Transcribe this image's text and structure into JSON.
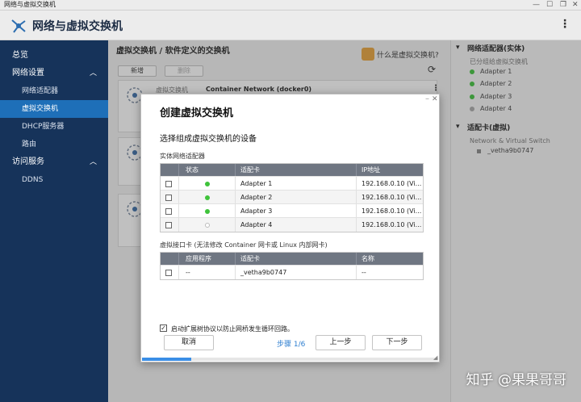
{
  "window": {
    "title": "网络与虚拟交换机"
  },
  "header": {
    "app_title": "网络与虚拟交换机",
    "menu_icon": "kebab-icon"
  },
  "sidebar": {
    "items": [
      {
        "label": "总览",
        "level": 0
      },
      {
        "label": "网络设置",
        "level": 0,
        "expanded": true
      },
      {
        "label": "网络适配器",
        "level": 1
      },
      {
        "label": "虚拟交换机",
        "level": 1,
        "active": true
      },
      {
        "label": "DHCP服务器",
        "level": 1
      },
      {
        "label": "路由",
        "level": 1
      },
      {
        "label": "访问服务",
        "level": 0,
        "expanded": true
      },
      {
        "label": "DDNS",
        "level": 1
      }
    ]
  },
  "main": {
    "title": "虚拟交换机 / 软件定义的交换机",
    "help_link": "什么是虚拟交换机?",
    "add_button": "新增",
    "delete_button": "删除",
    "card": {
      "label": "虚拟交换机",
      "name": "Container Network (docker0)"
    }
  },
  "right_panel": {
    "section1_title": "网络适配器(实体)",
    "section1_subtitle": "已分组给虚拟交换机",
    "adapters": [
      {
        "name": "Adapter 1",
        "status": "connected"
      },
      {
        "name": "Adapter 2",
        "status": "connected"
      },
      {
        "name": "Adapter 3",
        "status": "connected"
      },
      {
        "name": "Adapter 4",
        "status": "disconnected"
      }
    ],
    "section2_title": "适配卡(虚拟)",
    "section2_subtitle": "Network & Virtual Switch",
    "virtual": [
      {
        "name": "_vetha9b0747"
      }
    ]
  },
  "dialog": {
    "title": "创建虚拟交换机",
    "subtitle": "选择组成虚拟交换机的设备",
    "physical_section": "实体网络适配器",
    "physical_headers": [
      "",
      "状态",
      "适配卡",
      "IP地址"
    ],
    "physical_rows": [
      {
        "status": "connected",
        "adapter": "Adapter 1",
        "ip": "192.168.0.10 (Vi..."
      },
      {
        "status": "connected",
        "adapter": "Adapter 2",
        "ip": "192.168.0.10 (Vi..."
      },
      {
        "status": "connected",
        "adapter": "Adapter 3",
        "ip": "192.168.0.10 (Vi..."
      },
      {
        "status": "disconnected",
        "adapter": "Adapter 4",
        "ip": "192.168.0.10 (Vi..."
      }
    ],
    "virtual_section": "虚拟接口卡 (无法修改 Container 网卡或 Linux 内部网卡)",
    "virtual_headers": [
      "",
      "应用程序",
      "适配卡",
      "名称"
    ],
    "virtual_rows": [
      {
        "app": "--",
        "adapter": "_vetha9b0747",
        "name": "--"
      }
    ],
    "stp_label": "启动扩展树协议以防止网桥发生循环回路。",
    "cancel_button": "取消",
    "step_label": "步骤 1/6",
    "prev_button": "上一步",
    "next_button": "下一步",
    "progress": 0.167
  },
  "watermark": "知乎 @果果哥哥",
  "colors": {
    "accent": "#1e6fb8",
    "sidebar_bg": "#16335a",
    "status_on": "#3fc33b",
    "table_header": "#6f7682"
  }
}
